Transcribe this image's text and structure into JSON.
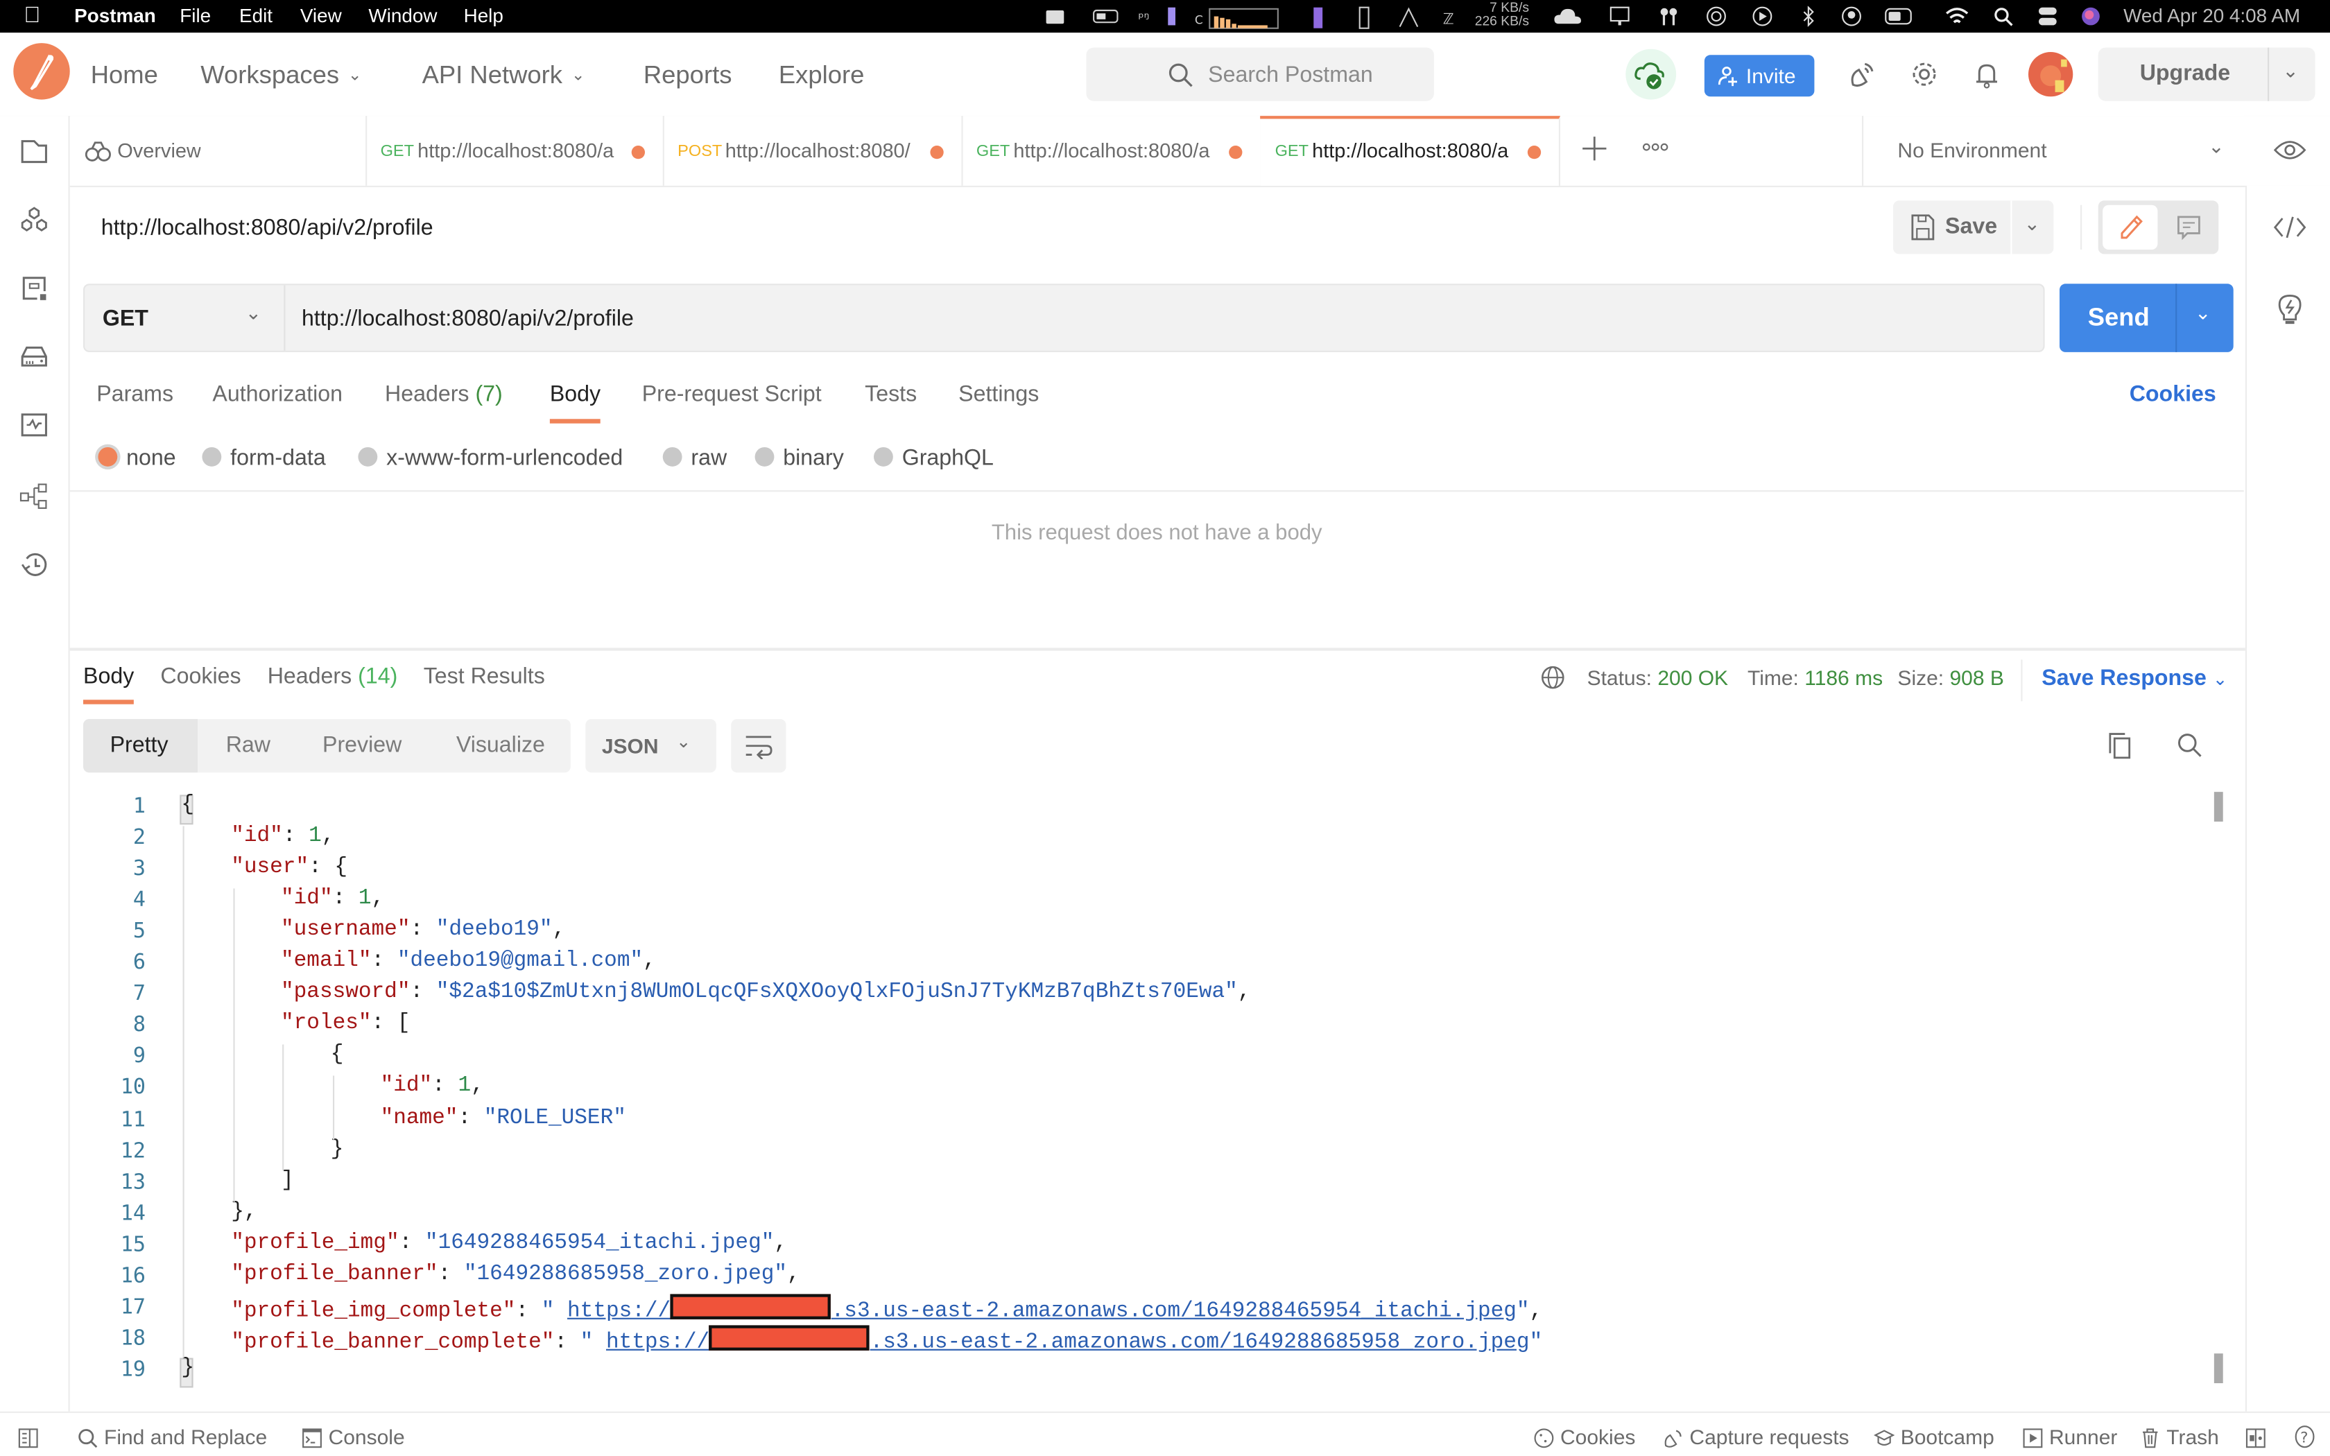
{
  "menubar": {
    "app_name": "Postman",
    "menus": [
      "File",
      "Edit",
      "View",
      "Window",
      "Help"
    ],
    "net_up": "7 KB/s",
    "net_down": "226 KB/s",
    "clock": "Wed Apr 20  4:08 AM"
  },
  "header": {
    "nav": [
      "Home",
      "Workspaces",
      "API Network",
      "Reports",
      "Explore"
    ],
    "search_placeholder": "Search Postman",
    "invite_label": "Invite",
    "upgrade_label": "Upgrade"
  },
  "tabs": {
    "overview_label": "Overview",
    "items": [
      {
        "method": "GET",
        "url": "http://localhost:8080/a",
        "unsaved": true,
        "active": false
      },
      {
        "method": "POST",
        "url": "http://localhost:8080/",
        "unsaved": true,
        "active": false
      },
      {
        "method": "GET",
        "url": "http://localhost:8080/a",
        "unsaved": true,
        "active": false
      },
      {
        "method": "GET",
        "url": "http://localhost:8080/a",
        "unsaved": true,
        "active": true
      }
    ],
    "environment": "No Environment"
  },
  "request": {
    "title": "http://localhost:8080/api/v2/profile",
    "save_label": "Save",
    "method": "GET",
    "url": "http://localhost:8080/api/v2/profile",
    "send_label": "Send",
    "subtabs": [
      {
        "label": "Params"
      },
      {
        "label": "Authorization"
      },
      {
        "label": "Headers",
        "count": "(7)"
      },
      {
        "label": "Body",
        "active": true
      },
      {
        "label": "Pre-request Script"
      },
      {
        "label": "Tests"
      },
      {
        "label": "Settings"
      }
    ],
    "cookies_label": "Cookies",
    "body_types": [
      "none",
      "form-data",
      "x-www-form-urlencoded",
      "raw",
      "binary",
      "GraphQL"
    ],
    "body_type_selected": "none",
    "no_body_message": "This request does not have a body"
  },
  "response": {
    "tabs": [
      {
        "label": "Body",
        "active": true
      },
      {
        "label": "Cookies"
      },
      {
        "label": "Headers",
        "count": "(14)"
      },
      {
        "label": "Test Results"
      }
    ],
    "status_label": "Status:",
    "status_value": "200 OK",
    "time_label": "Time:",
    "time_value": "1186 ms",
    "size_label": "Size:",
    "size_value": "908 B",
    "save_response_label": "Save Response",
    "formats": [
      "Pretty",
      "Raw",
      "Preview",
      "Visualize"
    ],
    "format_selected": "Pretty",
    "language": "JSON",
    "lines": [
      {
        "n": "1",
        "indent": 0,
        "parts": [
          [
            "p",
            "{"
          ]
        ]
      },
      {
        "n": "2",
        "indent": 1,
        "parts": [
          [
            "k",
            "\"id\""
          ],
          [
            "p",
            ": "
          ],
          [
            "n",
            "1"
          ],
          [
            "p",
            ","
          ]
        ]
      },
      {
        "n": "3",
        "indent": 1,
        "parts": [
          [
            "k",
            "\"user\""
          ],
          [
            "p",
            ": {"
          ]
        ]
      },
      {
        "n": "4",
        "indent": 2,
        "parts": [
          [
            "k",
            "\"id\""
          ],
          [
            "p",
            ": "
          ],
          [
            "n",
            "1"
          ],
          [
            "p",
            ","
          ]
        ]
      },
      {
        "n": "5",
        "indent": 2,
        "parts": [
          [
            "k",
            "\"username\""
          ],
          [
            "p",
            ": "
          ],
          [
            "s",
            "\"deebo19\""
          ],
          [
            "p",
            ","
          ]
        ]
      },
      {
        "n": "6",
        "indent": 2,
        "parts": [
          [
            "k",
            "\"email\""
          ],
          [
            "p",
            ": "
          ],
          [
            "s",
            "\"deebo19@gmail.com\""
          ],
          [
            "p",
            ","
          ]
        ]
      },
      {
        "n": "7",
        "indent": 2,
        "parts": [
          [
            "k",
            "\"password\""
          ],
          [
            "p",
            ": "
          ],
          [
            "s",
            "\"$2a$10$ZmUtxnj8WUmOLqcQFsXQXOoyQlxFOjuSnJ7TyKMzB7qBhZts70Ewa\""
          ],
          [
            "p",
            ","
          ]
        ]
      },
      {
        "n": "8",
        "indent": 2,
        "parts": [
          [
            "k",
            "\"roles\""
          ],
          [
            "p",
            ": ["
          ]
        ]
      },
      {
        "n": "9",
        "indent": 3,
        "parts": [
          [
            "p",
            "{"
          ]
        ]
      },
      {
        "n": "10",
        "indent": 4,
        "parts": [
          [
            "k",
            "\"id\""
          ],
          [
            "p",
            ": "
          ],
          [
            "n",
            "1"
          ],
          [
            "p",
            ","
          ]
        ]
      },
      {
        "n": "11",
        "indent": 4,
        "parts": [
          [
            "k",
            "\"name\""
          ],
          [
            "p",
            ": "
          ],
          [
            "s",
            "\"ROLE_USER\""
          ]
        ]
      },
      {
        "n": "12",
        "indent": 3,
        "parts": [
          [
            "p",
            "}"
          ]
        ]
      },
      {
        "n": "13",
        "indent": 2,
        "parts": [
          [
            "p",
            "]"
          ]
        ]
      },
      {
        "n": "14",
        "indent": 1,
        "parts": [
          [
            "p",
            "},"
          ]
        ]
      },
      {
        "n": "15",
        "indent": 1,
        "parts": [
          [
            "k",
            "\"profile_img\""
          ],
          [
            "p",
            ": "
          ],
          [
            "s",
            "\"1649288465954_itachi.jpeg\""
          ],
          [
            "p",
            ","
          ]
        ]
      },
      {
        "n": "16",
        "indent": 1,
        "parts": [
          [
            "k",
            "\"profile_banner\""
          ],
          [
            "p",
            ": "
          ],
          [
            "s",
            "\"1649288685958_zoro.jpeg\""
          ],
          [
            "p",
            ","
          ]
        ]
      },
      {
        "n": "17",
        "indent": 1,
        "parts": [
          [
            "k",
            "\"profile_img_complete\""
          ],
          [
            "p",
            ": "
          ],
          [
            "s",
            "\" "
          ],
          [
            "l",
            "https://"
          ],
          [
            "r",
            ""
          ],
          [
            "l",
            ".s3.us-east-2.amazonaws.com/1649288465954_itachi.jpeg"
          ],
          [
            "s",
            "\""
          ],
          [
            "p",
            ","
          ]
        ]
      },
      {
        "n": "18",
        "indent": 1,
        "parts": [
          [
            "k",
            "\"profile_banner_complete\""
          ],
          [
            "p",
            ": "
          ],
          [
            "s",
            "\" "
          ],
          [
            "l",
            "https://"
          ],
          [
            "r",
            ""
          ],
          [
            "l",
            ".s3.us-east-2.amazonaws.com/1649288685958_zoro.jpeg"
          ],
          [
            "s",
            "\""
          ]
        ]
      },
      {
        "n": "19",
        "indent": 0,
        "parts": [
          [
            "p",
            "}"
          ]
        ]
      }
    ]
  },
  "footer": {
    "left": [
      "Find and Replace",
      "Console"
    ],
    "right": [
      "Cookies",
      "Capture requests",
      "Bootcamp",
      "Runner",
      "Trash"
    ]
  },
  "colors": {
    "brand": "#f08358",
    "primary": "#4087e6",
    "success": "#3f8f3f",
    "get_method": "#4bb35e",
    "post_method": "#f5b120",
    "json_key": "#a31515",
    "json_string": "#2a5db0",
    "json_number": "#2e8a4a"
  }
}
